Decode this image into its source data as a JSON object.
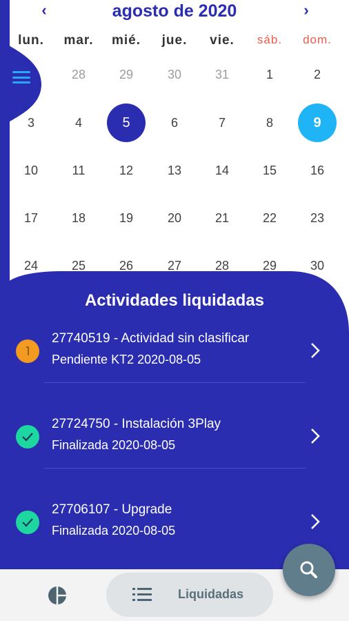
{
  "calendar": {
    "month_title": "agosto de 2020",
    "prev_icon": "chevron-left-icon",
    "next_icon": "chevron-right-icon",
    "weekdays": [
      "lun.",
      "mar.",
      "mié.",
      "jue.",
      "vie.",
      "sáb.",
      "dom."
    ],
    "weeks": [
      [
        "",
        "28",
        "29",
        "30",
        "31",
        "1",
        "2"
      ],
      [
        "3",
        "4",
        "5",
        "6",
        "7",
        "8",
        "9"
      ],
      [
        "10",
        "11",
        "12",
        "13",
        "14",
        "15",
        "16"
      ],
      [
        "17",
        "18",
        "19",
        "20",
        "21",
        "22",
        "23"
      ],
      [
        "24",
        "25",
        "26",
        "27",
        "28",
        "29",
        "30"
      ]
    ],
    "selected_day": "5",
    "today_day": "9",
    "colors": {
      "primary": "#2a2db0",
      "today": "#1eb4f5",
      "weekend": "#f05a4a"
    }
  },
  "menu_icon": "hamburger-menu-icon",
  "activities": {
    "title": "Actividades liquidadas",
    "items": [
      {
        "line1": "27740519 - Actividad sin clasificar",
        "line2": "Pendiente KT2 2020-08-05",
        "status": "pending",
        "icon": "pending-status-icon"
      },
      {
        "line1": "27724750 - Instalación 3Play",
        "line2": "Finalizada 2020-08-05",
        "status": "done",
        "icon": "check-icon"
      },
      {
        "line1": "27706107 - Upgrade",
        "line2": "Finalizada 2020-08-05",
        "status": "done",
        "icon": "check-icon"
      }
    ]
  },
  "bottom_nav": {
    "chart_icon": "pie-chart-icon",
    "list_icon": "list-icon",
    "active_tab_label": "Liquidadas"
  },
  "fab": {
    "icon": "search-icon",
    "color": "#607d8b"
  }
}
